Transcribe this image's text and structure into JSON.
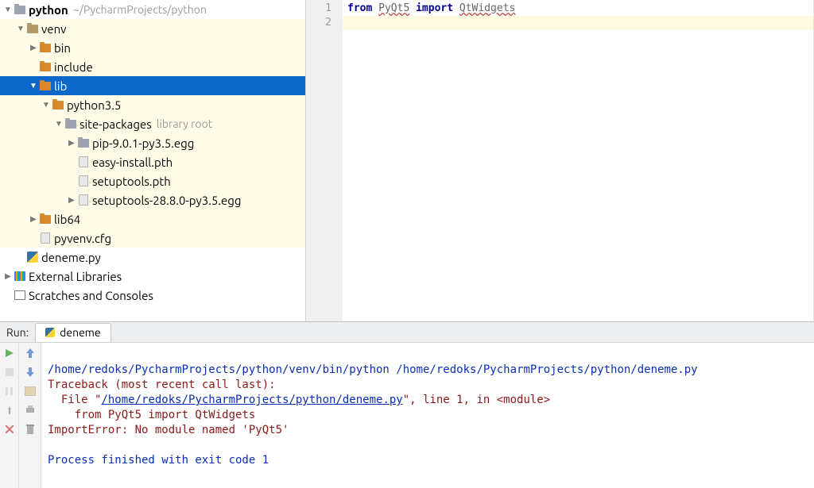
{
  "project": {
    "name": "python",
    "path": "~/PycharmProjects/python"
  },
  "tree": {
    "rows": [
      {
        "indent": 0,
        "arrow": "down",
        "icon": "folder-grey",
        "label": "python",
        "bold": true,
        "hint": "~/PycharmProjects/python",
        "hl": false,
        "sel": false
      },
      {
        "indent": 1,
        "arrow": "down",
        "icon": "folder-brown",
        "label": "venv",
        "hl": true,
        "sel": false
      },
      {
        "indent": 2,
        "arrow": "right",
        "icon": "folder-orange",
        "label": "bin",
        "hl": true,
        "sel": false
      },
      {
        "indent": 2,
        "arrow": "none",
        "icon": "folder-orange",
        "label": "include",
        "hl": true,
        "sel": false
      },
      {
        "indent": 2,
        "arrow": "down",
        "icon": "folder-orange",
        "label": "lib",
        "hl": true,
        "sel": true
      },
      {
        "indent": 3,
        "arrow": "down",
        "icon": "folder-orange",
        "label": "python3.5",
        "hl": true,
        "sel": false
      },
      {
        "indent": 4,
        "arrow": "down",
        "icon": "folder-grey",
        "label": "site-packages",
        "hint": "library root",
        "hl": true,
        "sel": false
      },
      {
        "indent": 5,
        "arrow": "right",
        "icon": "folder-grey",
        "label": "pip-9.0.1-py3.5.egg",
        "hl": true,
        "sel": false
      },
      {
        "indent": 5,
        "arrow": "none",
        "icon": "file",
        "label": "easy-install.pth",
        "hl": true,
        "sel": false
      },
      {
        "indent": 5,
        "arrow": "none",
        "icon": "file",
        "label": "setuptools.pth",
        "hl": true,
        "sel": false
      },
      {
        "indent": 5,
        "arrow": "right",
        "icon": "file",
        "label": "setuptools-28.8.0-py3.5.egg",
        "hl": true,
        "sel": false
      },
      {
        "indent": 2,
        "arrow": "right",
        "icon": "folder-orange",
        "label": "lib64",
        "hl": true,
        "sel": false
      },
      {
        "indent": 2,
        "arrow": "none",
        "icon": "file",
        "label": "pyvenv.cfg",
        "hl": true,
        "sel": false
      },
      {
        "indent": 1,
        "arrow": "none",
        "icon": "py",
        "label": "deneme.py",
        "hl": false,
        "sel": false
      },
      {
        "indent": 0,
        "arrow": "right",
        "icon": "lib",
        "label": "External Libraries",
        "hl": false,
        "sel": false
      },
      {
        "indent": 0,
        "arrow": "none",
        "icon": "sc",
        "label": "Scratches and Consoles",
        "hl": false,
        "sel": false
      }
    ]
  },
  "editor": {
    "gutter": [
      "1",
      "2"
    ],
    "line1": {
      "kw1": "from",
      "mod": "PyQt5",
      "kw2": "import",
      "cls": "QtWidgets"
    }
  },
  "run": {
    "panel_label": "Run:",
    "tab": "deneme",
    "lines": {
      "cmd": "/home/redoks/PycharmProjects/python/venv/bin/python /home/redoks/PycharmProjects/python/deneme.py",
      "tb": "Traceback (most recent call last):",
      "file_prefix": "  File \"",
      "file_link": "/home/redoks/PycharmProjects/python/deneme.py",
      "file_suffix": "\", line 1, in <module>",
      "import_line": "    from PyQt5 import QtWidgets",
      "err": "ImportError: No module named 'PyQt5'",
      "blank": "",
      "exit": "Process finished with exit code 1"
    }
  },
  "colors": {
    "selection": "#0d67c9",
    "venvBg": "#fffbe6"
  }
}
